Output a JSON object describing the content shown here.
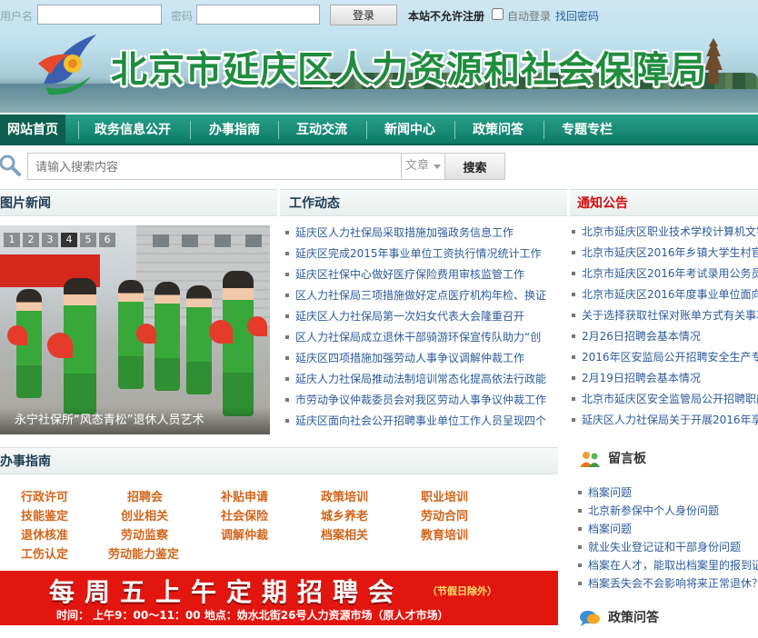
{
  "login": {
    "user_label": "用户名",
    "pass_label": "密码",
    "user_value": "",
    "pass_value": "",
    "button": "登录",
    "note": "本站不允许注册",
    "auto_login": "自动登录",
    "find_pw": "找回密码"
  },
  "banner": {
    "title": "北京市延庆区人力资源和社会保障局"
  },
  "nav": [
    "网站首页",
    "政务信息公开",
    "办事指南",
    "互动交流",
    "新闻中心",
    "政策问答",
    "专题专栏"
  ],
  "search": {
    "placeholder": "请输入搜索内容",
    "scope": "文章",
    "button": "搜索"
  },
  "photo_news": {
    "title": "图片新闻",
    "pages": [
      "1",
      "2",
      "3",
      "4",
      "5",
      "6"
    ],
    "caption": "永宁社保所“风态青松”退休人员艺术"
  },
  "work": {
    "title": "工作动态",
    "items": [
      "延庆区人力社保局采取措施加强政务信息工作",
      "延庆区完成2015年事业单位工资执行情况统计工作",
      "延庆区社保中心做好医疗保险费用审核监管工作",
      "区人力社保局三项措施做好定点医疗机构年检、换证",
      "延庆区人力社保局第一次妇女代表大会隆重召开",
      "区人力社保局成立退休干部骑游环保宣传队助力“创",
      "延庆区四项措施加强劳动人事争议调解仲裁工作",
      "延庆人力社保局推动法制培训常态化提高依法行政能",
      "市劳动争议仲裁委员会对我区劳动人事争议仲裁工作",
      "延庆区面向社会公开招聘事业单位工作人员呈现四个"
    ]
  },
  "notice": {
    "title": "通知公告",
    "items": [
      "北京市延庆区职业技术学校计算机文字",
      "北京市延庆区2016年乡镇大学生村官专",
      "北京市延庆区2016年考试录用公务员面",
      "北京市延庆区2016年度事业单位面向社",
      "关于选择获取社保对账单方式有关事项",
      "2月26日招聘会基本情况",
      "2016年区安监局公开招聘安全生产专职",
      "2月19日招聘会基本情况",
      "北京市延庆区安全监管局公开招聘职能",
      "延庆区人力社保局关于开展2016年享受"
    ]
  },
  "guide": {
    "title": "办事指南",
    "rows": [
      [
        "行政许可",
        "招聘会",
        "补贴申请",
        "政策培训",
        "职业培训"
      ],
      [
        "技能鉴定",
        "创业相关",
        "社会保险",
        "城乡养老",
        "劳动合同"
      ],
      [
        "退休核准",
        "劳动监察",
        "调解仲裁",
        "档案相关",
        "教育培训"
      ],
      [
        "工伤认定",
        "劳动能力鉴定"
      ]
    ]
  },
  "recruit": {
    "headline": "每周五上午定期招聘会",
    "holiday_note": "（节假日除外）",
    "time_line": "时间：   上午9：00～11：00      地点：妫水北街26号人力资源市场（原人才市场）"
  },
  "message_board": {
    "title": "留言板",
    "items": [
      "档案问题",
      "北京新参保中个人身份问题",
      "档案问题",
      "就业失业登记证和干部身份问题",
      "档案在人才，能取出档案里的报到证",
      "档案丢失会不会影响将来正常退休？"
    ]
  },
  "policy_qa": {
    "title": "政策问答"
  },
  "colors": {
    "nav_bg": "#0e7a67",
    "accent_red": "#d40c0c",
    "guide_orange": "#d2661b",
    "link_blue": "#2d5b9a"
  }
}
